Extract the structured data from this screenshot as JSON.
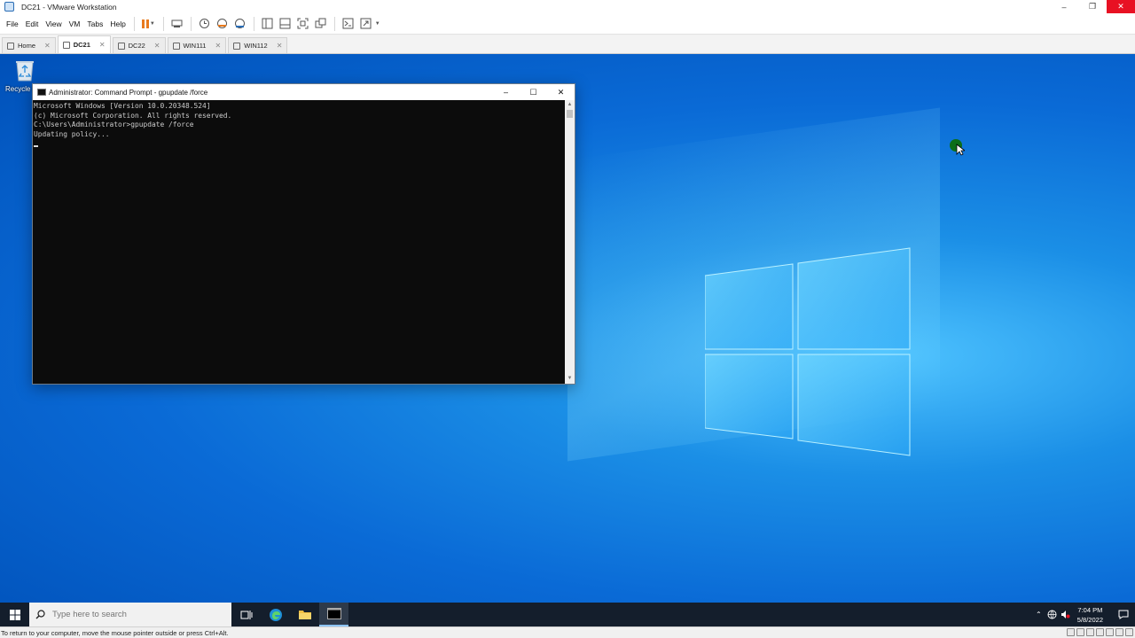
{
  "window": {
    "title": "DC21 - VMware Workstation"
  },
  "menu": [
    "File",
    "Edit",
    "View",
    "VM",
    "Tabs",
    "Help"
  ],
  "tabs": [
    {
      "label": "Home",
      "active": false
    },
    {
      "label": "DC21",
      "active": true
    },
    {
      "label": "DC22",
      "active": false
    },
    {
      "label": "WIN111",
      "active": false
    },
    {
      "label": "WIN112",
      "active": false
    }
  ],
  "desktop": {
    "recycle_bin_label": "Recycle Bin"
  },
  "cmd": {
    "title": "Administrator: Command Prompt - gpupdate  /force",
    "lines": [
      "Microsoft Windows [Version 10.0.20348.524]",
      "(c) Microsoft Corporation. All rights reserved.",
      "",
      "C:\\Users\\Administrator>gpupdate /force",
      "Updating policy..."
    ]
  },
  "taskbar": {
    "search_placeholder": "Type here to search",
    "time": "7:04 PM",
    "date": "5/8/2022"
  },
  "statusbar": {
    "text": "To return to your computer, move the mouse pointer outside or press Ctrl+Alt."
  },
  "colors": {
    "accent_pause": "#e87a1e",
    "close_red": "#e81123",
    "desktop_blue": "#0a6ad6",
    "taskbar": "#141e2c"
  }
}
